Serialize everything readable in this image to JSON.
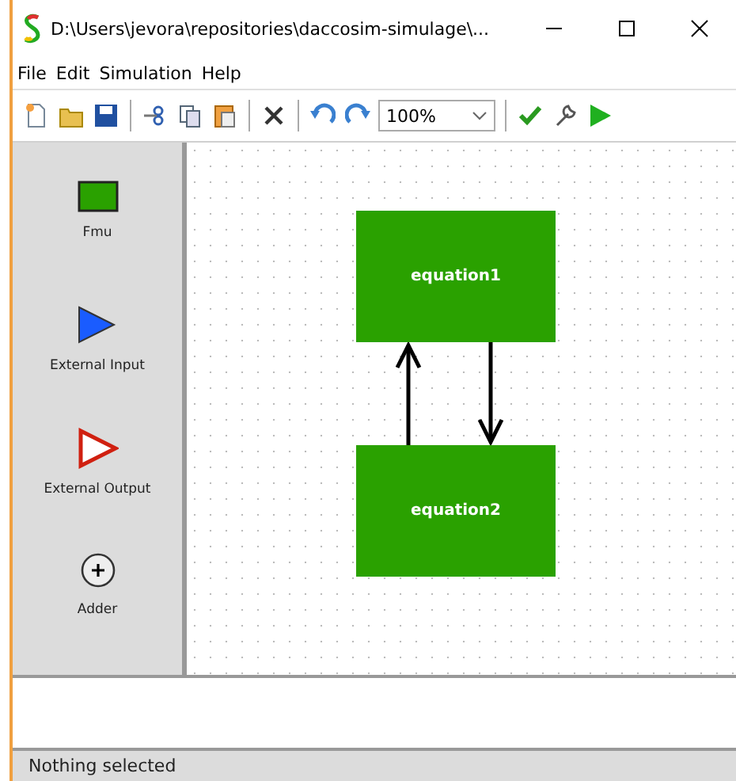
{
  "window": {
    "title": "D:\\Users\\jevora\\repositories\\daccosim-simulage\\..."
  },
  "menu": [
    "File",
    "Edit",
    "Simulation",
    "Help"
  ],
  "toolbar": {
    "zoom": "100%"
  },
  "palette": [
    {
      "kind": "fmu",
      "label": "Fmu"
    },
    {
      "kind": "input",
      "label": "External Input"
    },
    {
      "kind": "output",
      "label": "External Output"
    },
    {
      "kind": "adder",
      "label": "Adder"
    }
  ],
  "canvas": {
    "nodes": [
      {
        "label": "equation1"
      },
      {
        "label": "equation2"
      }
    ]
  },
  "status_bar": "Nothing selected"
}
